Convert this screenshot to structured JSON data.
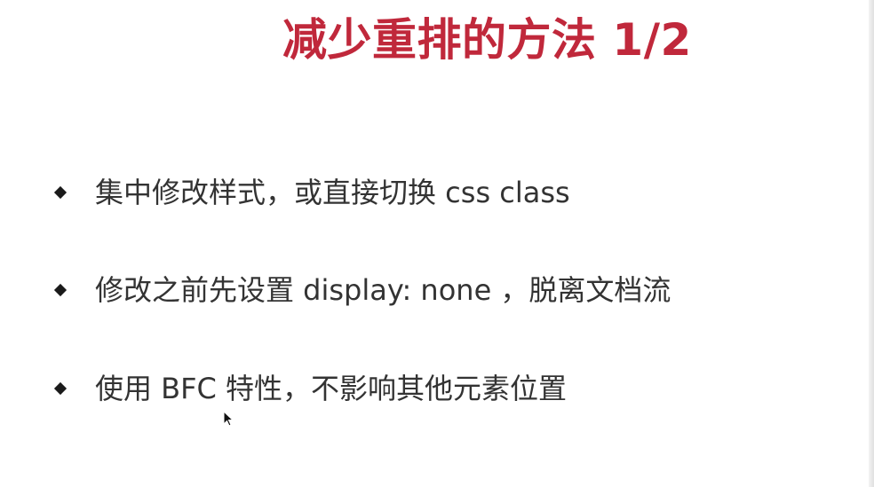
{
  "slide": {
    "title": "减少重排的方法 1/2",
    "title_color": "#c0283b",
    "bullets": [
      {
        "text": "集中修改样式，或直接切换 css class"
      },
      {
        "text": "修改之前先设置 display: none ，脱离文档流"
      },
      {
        "text": "使用 BFC 特性，不影响其他元素位置"
      }
    ],
    "bullet_icon": "diamond-bullet-icon",
    "cursor_icon": "mouse-pointer-icon"
  }
}
